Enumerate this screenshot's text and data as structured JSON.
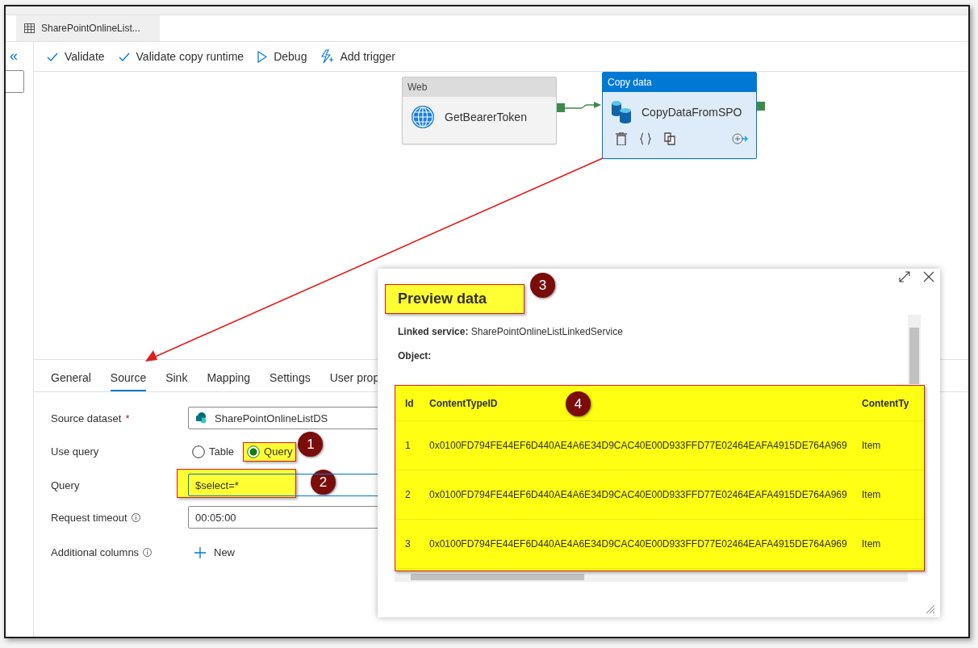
{
  "tab": {
    "label": "SharePointOnlineList..."
  },
  "collapse_button": "«",
  "toolbar": [
    {
      "label": "Validate",
      "kind": "check"
    },
    {
      "label": "Validate copy runtime",
      "kind": "check"
    },
    {
      "label": "Debug",
      "kind": "play"
    },
    {
      "label": "Add trigger",
      "kind": "trigger"
    }
  ],
  "activities": [
    {
      "type_label": "Web",
      "name": "GetBearerToken",
      "kind": "web",
      "selected": false
    },
    {
      "type_label": "Copy data",
      "name": "CopyDataFromSPO",
      "kind": "copy",
      "selected": true
    }
  ],
  "panel": {
    "tabs": [
      {
        "label": "General",
        "selected": false
      },
      {
        "label": "Source",
        "selected": true
      },
      {
        "label": "Sink",
        "selected": false
      },
      {
        "label": "Mapping",
        "selected": false
      },
      {
        "label": "Settings",
        "selected": false
      },
      {
        "label": "User prop",
        "selected": false
      }
    ],
    "fields": [
      {
        "label": "Source dataset",
        "required_mark": "*",
        "kind": "dataset",
        "value": "SharePointOnlineListDS"
      },
      {
        "label": "Use query",
        "kind": "radio",
        "options": [
          {
            "label": "Table",
            "selected": false,
            "highlighted": false
          },
          {
            "label": "Query",
            "selected": true,
            "highlighted": true,
            "marker": "1"
          }
        ]
      },
      {
        "label": "Query",
        "kind": "text",
        "value": "$select=*",
        "highlighted": true,
        "marker": "2"
      },
      {
        "label": "Request timeout",
        "info": true,
        "kind": "text",
        "value": "00:05:00",
        "highlighted": false
      },
      {
        "label": "Additional columns",
        "info": true,
        "kind": "add",
        "button": "New"
      }
    ]
  },
  "preview": {
    "title": "Preview data",
    "title_highlighted": true,
    "title_marker": "3",
    "linked_service_label": "Linked service:",
    "linked_service": "SharePointOnlineListLinkedService",
    "object_label": "Object:",
    "table": {
      "highlighted": true,
      "marker": "4",
      "columns": [
        "Id",
        "ContentTypeID",
        "ContentTy"
      ],
      "rows": [
        [
          "1",
          "0x0100FD794FE44EF6D440AE4A6E34D9CAC40E00D933FFD77E02464EAFA4915DE764A969",
          "Item"
        ],
        [
          "2",
          "0x0100FD794FE44EF6D440AE4A6E34D9CAC40E00D933FFD77E02464EAFA4915DE764A969",
          "Item"
        ],
        [
          "3",
          "0x0100FD794FE44EF6D440AE4A6E34D9CAC40E00D933FFD77E02464EAFA4915DE764A969",
          "Item"
        ]
      ]
    }
  }
}
